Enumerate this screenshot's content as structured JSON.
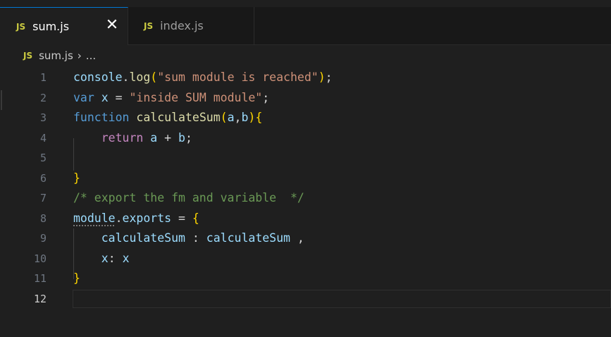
{
  "tabs": [
    {
      "icon": "JS",
      "label": "sum.js",
      "active": true,
      "close": "✕"
    },
    {
      "icon": "JS",
      "label": "index.js",
      "active": false
    }
  ],
  "breadcrumb": {
    "icon": "JS",
    "file": "sum.js",
    "separator": "›",
    "more": "..."
  },
  "colors": {
    "accent": "#0078d4",
    "js_icon": "#cbcb41",
    "editor_bg": "#1f1f1f"
  },
  "editor": {
    "current_line": 12,
    "lines": [
      {
        "n": "1"
      },
      {
        "n": "2"
      },
      {
        "n": "3"
      },
      {
        "n": "4"
      },
      {
        "n": "5"
      },
      {
        "n": "6"
      },
      {
        "n": "7"
      },
      {
        "n": "8"
      },
      {
        "n": "9"
      },
      {
        "n": "10"
      },
      {
        "n": "11"
      },
      {
        "n": "12"
      }
    ],
    "tokens": {
      "l1": [
        "console",
        ".",
        "log",
        "(",
        "\"sum module is reached\"",
        ")",
        ";"
      ],
      "l2": [
        "var",
        " ",
        "x",
        " = ",
        "\"inside SUM module\"",
        ";"
      ],
      "l3": [
        "function",
        " ",
        "calculateSum",
        "(",
        "a",
        ",",
        "b",
        ")",
        "{"
      ],
      "l4": [
        "    ",
        "return",
        " ",
        "a",
        " + ",
        "b",
        ";"
      ],
      "l6": [
        "}"
      ],
      "l7": [
        "/* export the fm and variable  */"
      ],
      "l8": [
        "module",
        ".",
        "exports",
        " = ",
        "{"
      ],
      "l9": [
        "    ",
        "calculateSum",
        " : ",
        "calculateSum",
        " ,"
      ],
      "l10": [
        "    ",
        "x",
        ": ",
        "x"
      ],
      "l11": [
        "}"
      ]
    }
  }
}
